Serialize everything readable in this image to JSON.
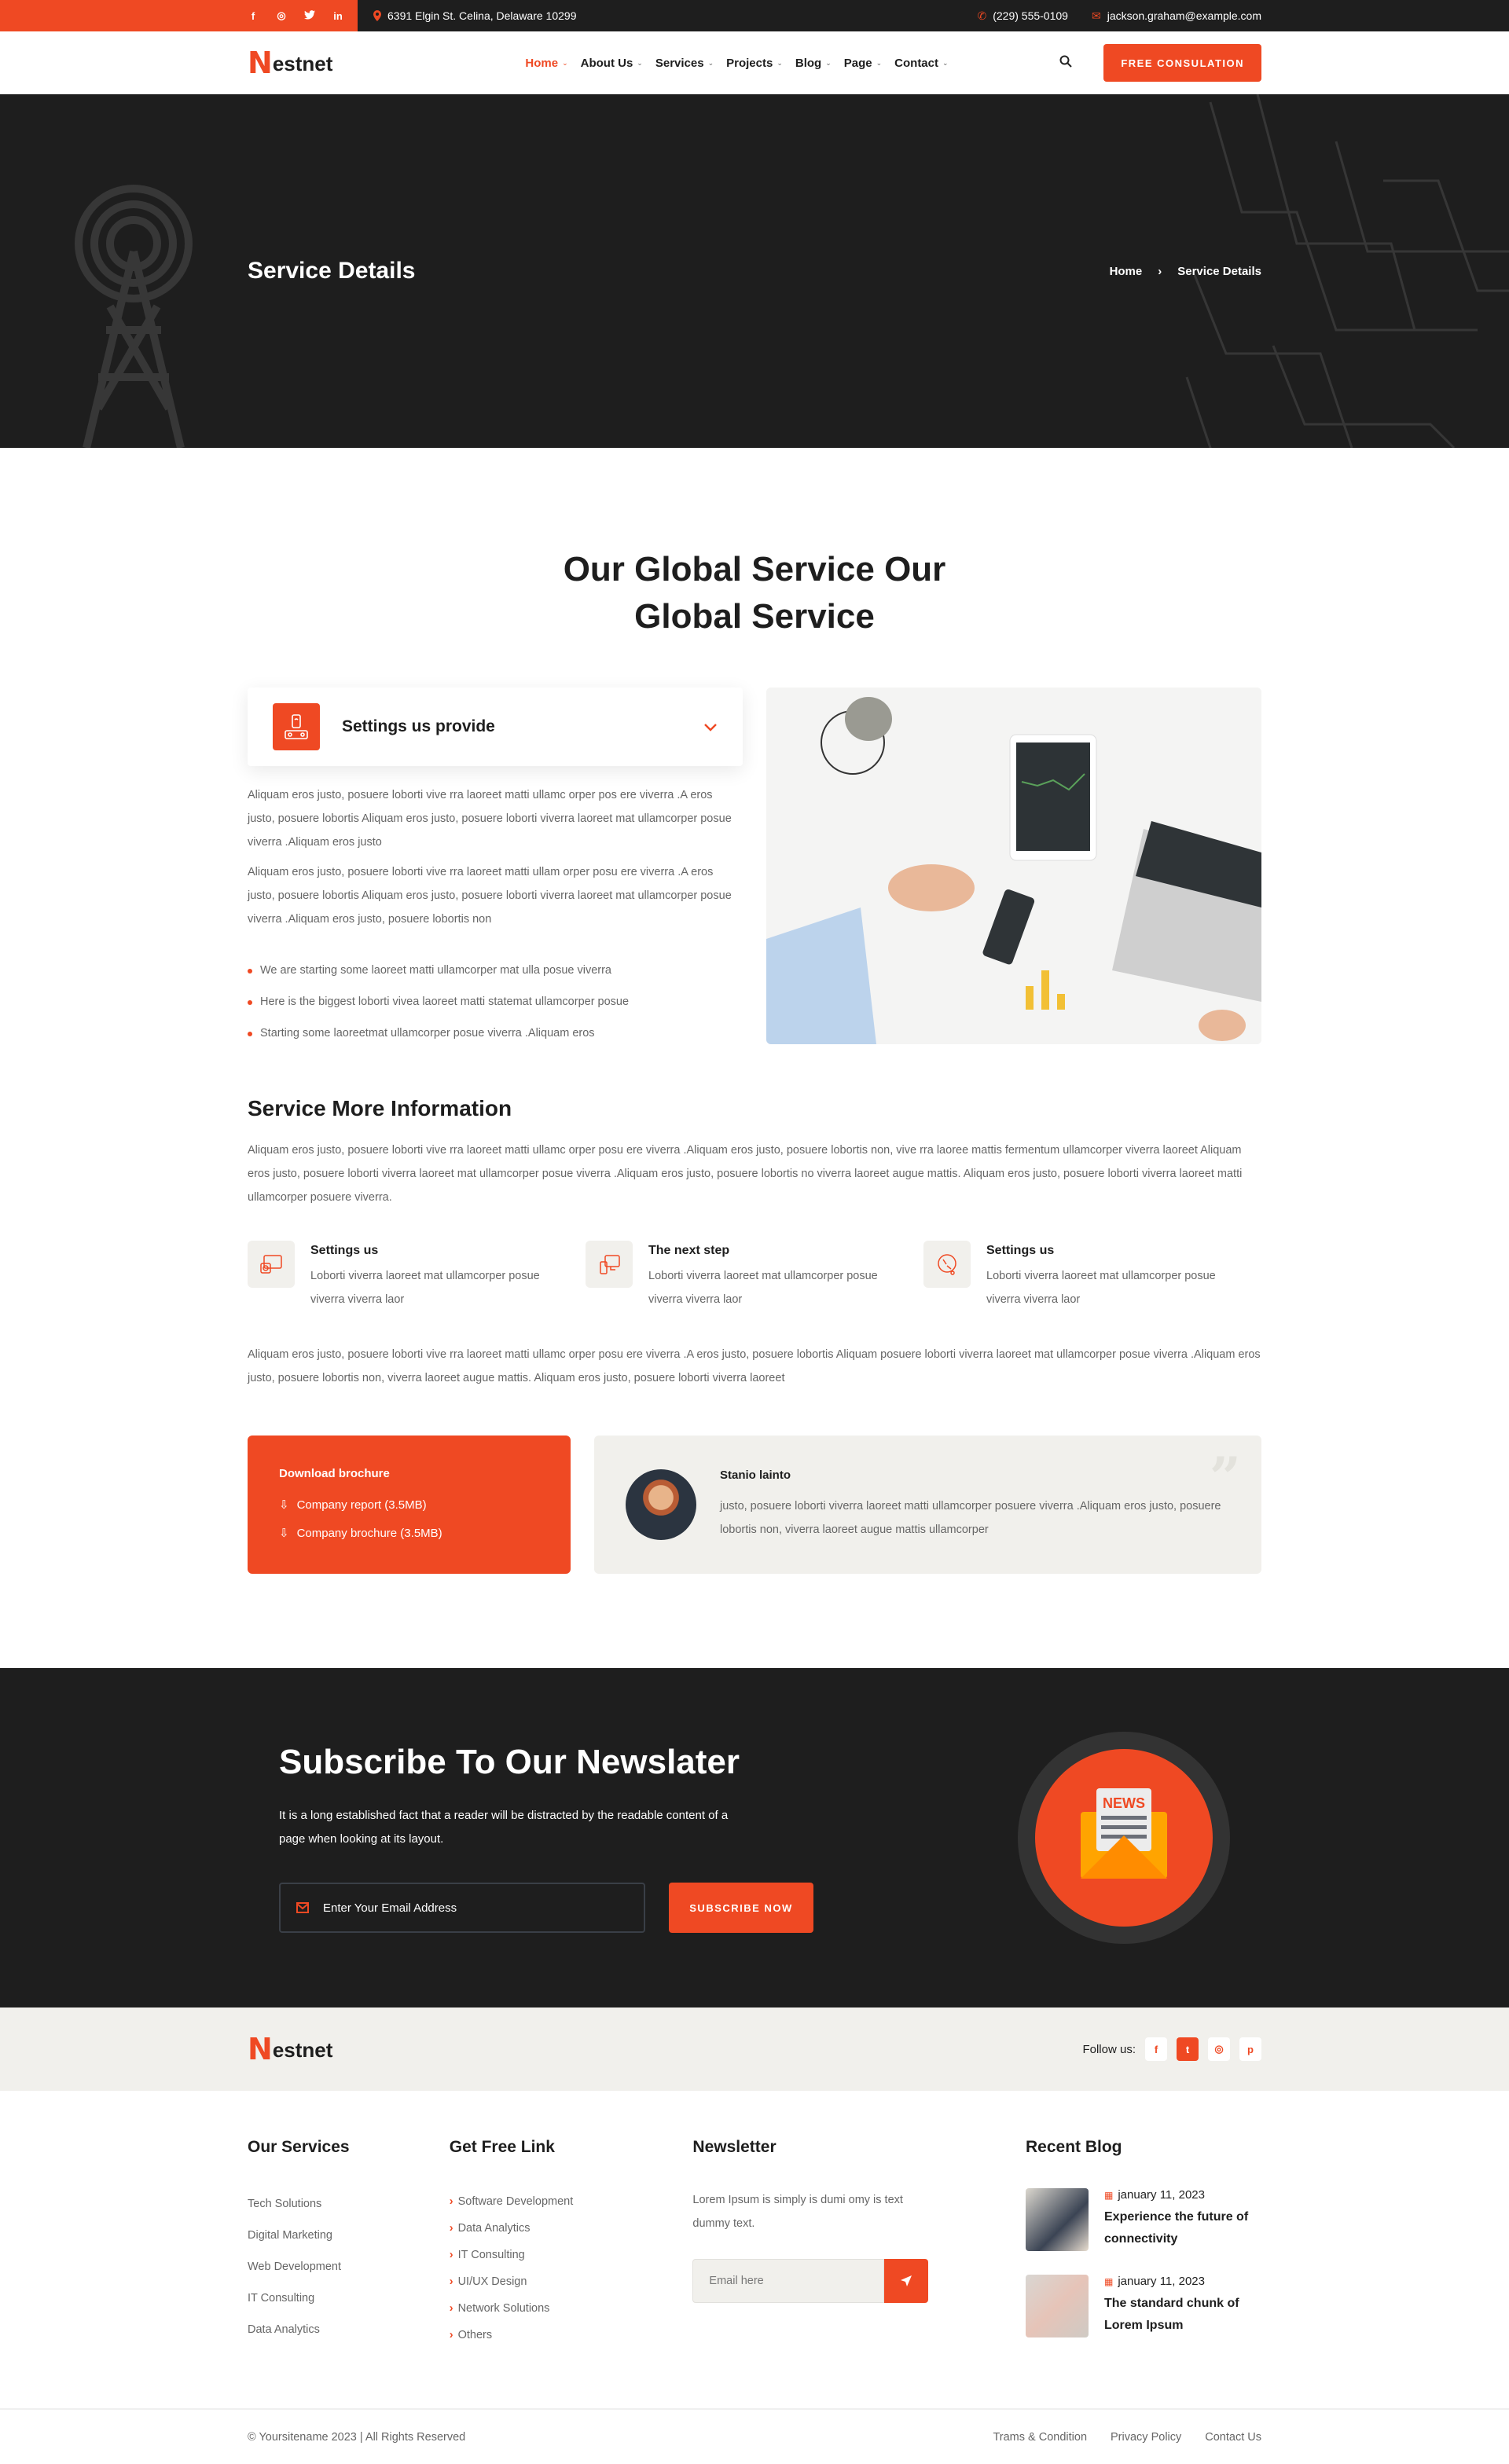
{
  "topbar": {
    "socials": [
      "facebook-icon",
      "instagram-icon",
      "twitter-icon",
      "linkedin-icon"
    ],
    "social_glyphs": [
      "f",
      "◎",
      "t",
      "in"
    ],
    "address": "6391 Elgin St. Celina, Delaware 10299",
    "phone": "(229) 555-0109",
    "email": "jackson.graham@example.com"
  },
  "header": {
    "logo_mark": "N",
    "logo_text": "estnet",
    "nav": [
      {
        "label": "Home",
        "active": true
      },
      {
        "label": "About Us"
      },
      {
        "label": "Services"
      },
      {
        "label": "Projects"
      },
      {
        "label": "Blog"
      },
      {
        "label": "Page"
      },
      {
        "label": "Contact"
      }
    ],
    "cta": "FREE CONSULATION"
  },
  "hero": {
    "title": "Service Details",
    "breadcrumb": [
      "Home",
      "Service Details"
    ],
    "separator": "›"
  },
  "main": {
    "title": "Our Global Service Our Global Service",
    "accordion_title": "Settings us provide",
    "paragraphs": [
      "Aliquam eros justo, posuere loborti vive rra laoreet matti ullamc orper pos ere viverra .A eros justo, posuere lobortis Aliquam eros justo, posuere loborti viverra laoreet mat ullamcorper posue viverra .Aliquam eros justo",
      "Aliquam eros justo, posuere loborti vive rra laoreet matti ullam orper posu ere viverra .A eros justo, posuere lobortis Aliquam eros justo, posuere loborti viverra laoreet mat ullamcorper posue viverra .Aliquam eros justo, posuere lobortis non"
    ],
    "bullets": [
      "We are starting some laoreet matti ullamcorper mat ulla posue viverra",
      "Here is the biggest loborti vivea laoreet matti statemat ullamcorper posue",
      "Starting some laoreetmat ullamcorper posue viverra .Aliquam eros"
    ],
    "more_title": "Service More Information",
    "more_paragraph": "Aliquam eros justo, posuere loborti vive rra laoreet matti ullamc orper posu ere viverra .Aliquam eros justo, posuere lobortis non, vive rra laoree mattis fermentum ullamcorper viverra laoreet Aliquam eros justo, posuere loborti viverra laoreet mat ullamcorper posue viverra .Aliquam eros justo, posuere lobortis no viverra laoreet augue mattis. Aliquam eros justo, posuere loborti viverra laoreet matti ullamcorper posuere viverra.",
    "features": [
      {
        "title": "Settings us",
        "text": "Loborti viverra laoreet mat ullamcorper posue viverra  viverra laor",
        "icon": "cast-tv-icon"
      },
      {
        "title": "The next step",
        "text": "Loborti viverra laoreet mat ullamcorper posue viverra  viverra laor",
        "icon": "phone-monitor-icon"
      },
      {
        "title": "Settings us",
        "text": "Loborti viverra laoreet mat ullamcorper posue viverra  viverra laor",
        "icon": "satellite-dish-icon"
      }
    ],
    "closing_paragraph": "Aliquam eros justo, posuere loborti vive rra laoreet matti ullamc orper posu ere viverra .A eros justo, posuere lobortis Aliquam posuere loborti viverra laoreet mat ullamcorper posue viverra .Aliquam eros justo, posuere lobortis non, viverra laoreet augue mattis. Aliquam eros justo, posuere loborti viverra laoreet",
    "download": {
      "title": "Download brochure",
      "files": [
        "Company report (3.5MB)",
        "Company brochure (3.5MB)"
      ]
    },
    "testimonial": {
      "name": "Stanio lainto",
      "text": "justo, posuere loborti viverra laoreet matti ullamcorper posuere viverra .Aliquam eros justo, posuere lobortis non, viverra laoreet augue mattis ullamcorper"
    }
  },
  "subscribe": {
    "title": "Subscribe To Our Newslater",
    "text": "It is a long established fact that a reader will be distracted by the readable content of a page when looking at its layout.",
    "placeholder": "Enter Your Email Address",
    "button": "SUBSCRIBE NOW",
    "badge_text": "NEWS"
  },
  "footer": {
    "follow_label": "Follow us:",
    "follow": [
      {
        "icon": "facebook-icon",
        "glyph": "f"
      },
      {
        "icon": "twitter-icon",
        "glyph": "t",
        "active": true
      },
      {
        "icon": "instagram-icon",
        "glyph": "◎"
      },
      {
        "icon": "pinterest-icon",
        "glyph": "p"
      }
    ],
    "services_title": "Our Services",
    "services": [
      "Tech Solutions",
      "Digital Marketing",
      "Web Development",
      "IT Consulting",
      "Data Analytics"
    ],
    "links_title": "Get Free Link",
    "links": [
      "Software Development",
      "Data Analytics",
      "IT Consulting",
      "UI/UX Design",
      "Network Solutions",
      "Others"
    ],
    "newsletter_title": "Newsletter",
    "newsletter_text": "Lorem Ipsum is simply is dumi omy is text  dummy text.",
    "newsletter_placeholder": "Email here",
    "blog_title": "Recent Blog",
    "blog": [
      {
        "date": "january 11, 2023",
        "title": "Experience the future of connectivity"
      },
      {
        "date": "january 11, 2023",
        "title": "The standard chunk of Lorem Ipsum"
      }
    ],
    "copyright": "© Yoursitename  2023 | All Rights Reserved",
    "bottom_links": [
      "Trams & Condition",
      "Privacy Policy",
      "Contact Us"
    ]
  },
  "colors": {
    "accent": "#ef4923",
    "dark": "#1e1e1e",
    "light": "#f1f0ec"
  }
}
